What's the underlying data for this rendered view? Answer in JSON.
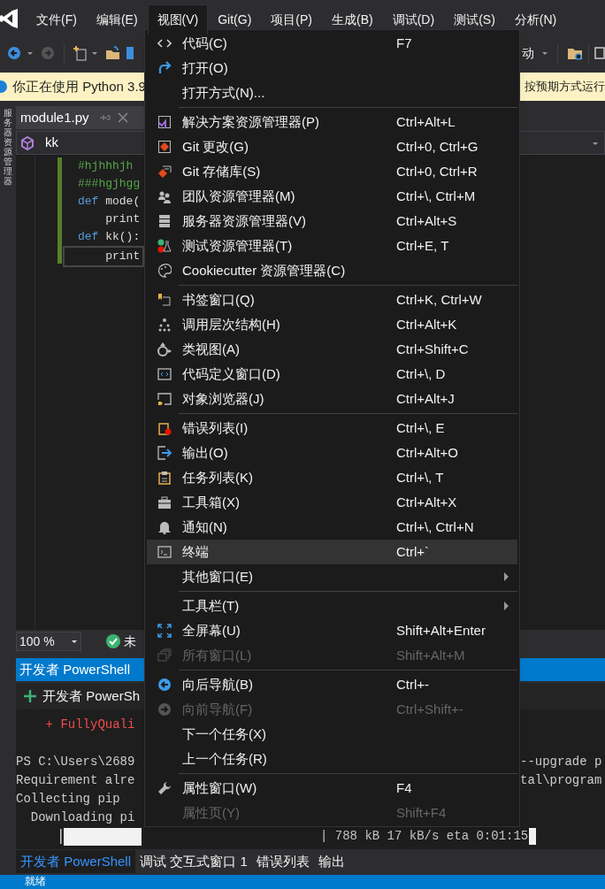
{
  "menu_bar": [
    {
      "label": "文件(F)",
      "selected": false
    },
    {
      "label": "编辑(E)",
      "selected": false
    },
    {
      "label": "视图(V)",
      "selected": true
    },
    {
      "label": "Git(G)",
      "selected": false
    },
    {
      "label": "项目(P)",
      "selected": false
    },
    {
      "label": "生成(B)",
      "selected": false
    },
    {
      "label": "调试(D)",
      "selected": false
    },
    {
      "label": "测试(S)",
      "selected": false
    },
    {
      "label": "分析(N)",
      "selected": false
    }
  ],
  "toolbar": {
    "start_label": "动"
  },
  "info_bar": {
    "text_left": "你正在使用 Python 3.9",
    "text_right": "按预期方式运行"
  },
  "side_strip": {
    "label": "服务器资源管理器"
  },
  "editor": {
    "tab": "module1.py",
    "nav_member": "kk",
    "lines": [
      {
        "kind": "comment",
        "text": "#hjhhhjh"
      },
      {
        "kind": "comment",
        "text": "###hgjhgg"
      },
      {
        "kind": "def",
        "keyword": "def",
        "text": "mode("
      },
      {
        "kind": "plain",
        "text": "    print"
      },
      {
        "kind": "def",
        "keyword": "def",
        "text": "kk():"
      },
      {
        "kind": "current",
        "text": "    print"
      }
    ]
  },
  "zoom_bar": {
    "zoom": "100 %",
    "status": "未"
  },
  "panel": {
    "title": "开发者 PowerShell",
    "toolbar_label": "开发者 PowerSh",
    "lines": [
      {
        "kind": "error",
        "left": "    + FullyQuali"
      },
      {
        "kind": "blank"
      },
      {
        "kind": "plain",
        "left": "PS C:\\Users\\2689",
        "right": "--upgrade p"
      },
      {
        "kind": "plain",
        "left": "Requirement alre",
        "right": "tal\\program"
      },
      {
        "kind": "plain",
        "left": "Collecting pip"
      },
      {
        "kind": "plain",
        "left": "  Downloading pi"
      },
      {
        "kind": "progress",
        "right": "| 788 kB 17 kB/s eta 0:01:15"
      }
    ],
    "tabs": [
      {
        "label": "开发者 PowerShell",
        "selected": true
      },
      {
        "label": "调试 交互式窗口 1",
        "selected": false
      },
      {
        "label": "错误列表",
        "selected": false
      },
      {
        "label": "输出",
        "selected": false
      }
    ]
  },
  "status_bar": {
    "text": "就绪"
  },
  "view_menu": {
    "groups": [
      [
        {
          "label": "代码(C)",
          "shortcut": "F7",
          "disabled": false,
          "selected": false
        },
        {
          "label": "打开(O)",
          "disabled": false,
          "selected": false
        },
        {
          "label": "打开方式(N)...",
          "disabled": false,
          "selected": false
        }
      ],
      [
        {
          "label": "解决方案资源管理器(P)",
          "shortcut": "Ctrl+Alt+L",
          "disabled": false,
          "selected": false
        },
        {
          "label": "Git 更改(G)",
          "shortcut": "Ctrl+0, Ctrl+G",
          "disabled": false,
          "selected": false
        },
        {
          "label": "Git 存储库(S)",
          "shortcut": "Ctrl+0, Ctrl+R",
          "disabled": false,
          "selected": false
        },
        {
          "label": "团队资源管理器(M)",
          "shortcut": "Ctrl+\\, Ctrl+M",
          "disabled": false,
          "selected": false
        },
        {
          "label": "服务器资源管理器(V)",
          "shortcut": "Ctrl+Alt+S",
          "disabled": false,
          "selected": false
        },
        {
          "label": "测试资源管理器(T)",
          "shortcut": "Ctrl+E, T",
          "disabled": false,
          "selected": false
        },
        {
          "label": "Cookiecutter 资源管理器(C)",
          "disabled": false,
          "selected": false
        }
      ],
      [
        {
          "label": "书签窗口(Q)",
          "shortcut": "Ctrl+K, Ctrl+W",
          "disabled": false,
          "selected": false
        },
        {
          "label": "调用层次结构(H)",
          "shortcut": "Ctrl+Alt+K",
          "disabled": false,
          "selected": false
        },
        {
          "label": "类视图(A)",
          "shortcut": "Ctrl+Shift+C",
          "disabled": false,
          "selected": false
        },
        {
          "label": "代码定义窗口(D)",
          "shortcut": "Ctrl+\\, D",
          "disabled": false,
          "selected": false
        },
        {
          "label": "对象浏览器(J)",
          "shortcut": "Ctrl+Alt+J",
          "disabled": false,
          "selected": false
        }
      ],
      [
        {
          "label": "错误列表(I)",
          "shortcut": "Ctrl+\\, E",
          "disabled": false,
          "selected": false
        },
        {
          "label": "输出(O)",
          "shortcut": "Ctrl+Alt+O",
          "disabled": false,
          "selected": false
        },
        {
          "label": "任务列表(K)",
          "shortcut": "Ctrl+\\, T",
          "disabled": false,
          "selected": false
        },
        {
          "label": "工具箱(X)",
          "shortcut": "Ctrl+Alt+X",
          "disabled": false,
          "selected": false
        },
        {
          "label": "通知(N)",
          "shortcut": "Ctrl+\\, Ctrl+N",
          "disabled": false,
          "selected": false
        },
        {
          "label": "终端",
          "shortcut": "Ctrl+`",
          "disabled": false,
          "selected": true
        },
        {
          "label": "其他窗口(E)",
          "submenu": true,
          "disabled": false,
          "selected": false
        }
      ],
      [
        {
          "label": "工具栏(T)",
          "submenu": true,
          "disabled": false,
          "selected": false
        },
        {
          "label": "全屏幕(U)",
          "shortcut": "Shift+Alt+Enter",
          "disabled": false,
          "selected": false
        },
        {
          "label": "所有窗口(L)",
          "shortcut": "Shift+Alt+M",
          "disabled": true,
          "selected": false
        }
      ],
      [
        {
          "label": "向后导航(B)",
          "shortcut": "Ctrl+-",
          "disabled": false,
          "selected": false
        },
        {
          "label": "向前导航(F)",
          "shortcut": "Ctrl+Shift+-",
          "disabled": true,
          "selected": false
        },
        {
          "label": "下一个任务(X)",
          "disabled": false,
          "selected": false
        },
        {
          "label": "上一个任务(R)",
          "disabled": false,
          "selected": false
        }
      ],
      [
        {
          "label": "属性窗口(W)",
          "shortcut": "F4",
          "disabled": false,
          "selected": false
        },
        {
          "label": "属性页(Y)",
          "shortcut": "Shift+F4",
          "disabled": true,
          "selected": false
        }
      ]
    ]
  }
}
